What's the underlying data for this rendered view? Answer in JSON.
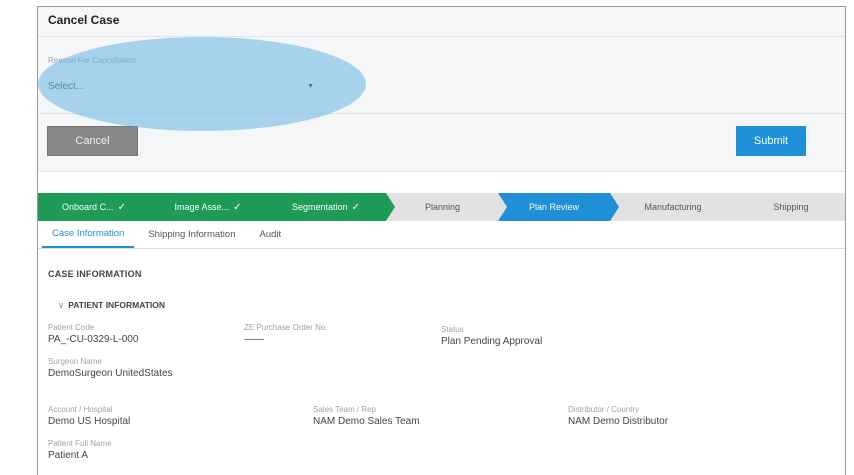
{
  "cancel": {
    "title": "Cancel Case",
    "reason_label": "Reason For Cancellation",
    "reason_value": "Select...",
    "cancel_label": "Cancel",
    "submit_label": "Submit"
  },
  "steps": [
    {
      "label": "Onboard C...",
      "state": "done"
    },
    {
      "label": "Image Asse...",
      "state": "done"
    },
    {
      "label": "Segmentation",
      "state": "done"
    },
    {
      "label": "Planning",
      "state": "todo"
    },
    {
      "label": "Plan Review",
      "state": "active"
    },
    {
      "label": "Manufacturing",
      "state": "todo"
    },
    {
      "label": "Shipping",
      "state": "todo"
    }
  ],
  "tabs": [
    {
      "label": "Case Information",
      "active": true
    },
    {
      "label": "Shipping Information",
      "active": false
    },
    {
      "label": "Audit",
      "active": false
    }
  ],
  "case": {
    "section_title": "CASE INFORMATION",
    "patient_title": "PATIENT INFORMATION",
    "patient_code_label": "Patient Code",
    "patient_code_value": "PA_-CU-0329-L-000",
    "po_label": "ZE Purchase Order No.",
    "po_value": "——",
    "status_label": "Status",
    "status_value": "Plan Pending Approval",
    "surgeon_label": "Surgeon Name",
    "surgeon_value": "DemoSurgeon UnitedStates",
    "account_label": "Account / Hospital",
    "account_value": "Demo US Hospital",
    "sales_label": "Sales Team / Rep",
    "sales_value": "NAM Demo Sales Team",
    "distributor_label": "Distributor / Country",
    "distributor_value": "NAM Demo Distributor",
    "fullname_label": "Patient Full Name",
    "fullname_value": "Patient A"
  },
  "colors": {
    "done": "#1e9b56",
    "active": "#1f8fd8",
    "todo": "#e2e2e2",
    "highlight": "#66b4e1"
  }
}
